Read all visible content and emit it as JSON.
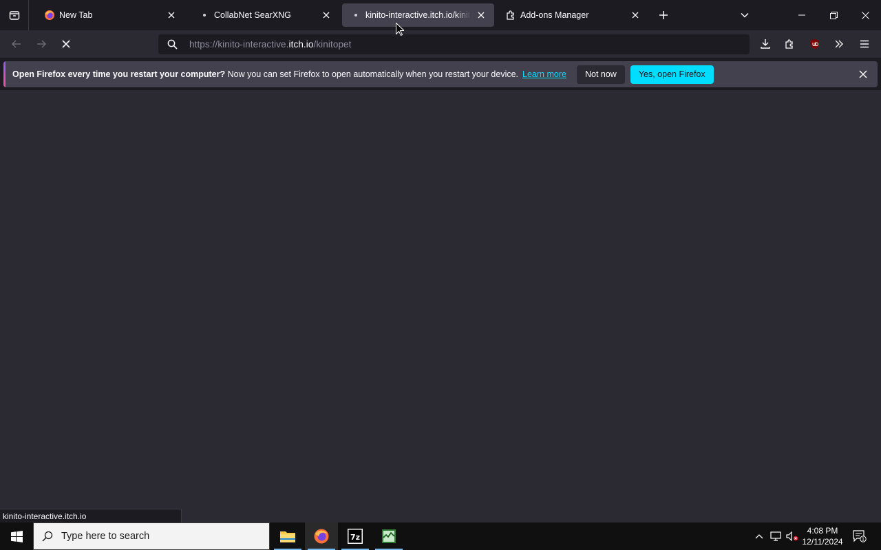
{
  "tabs": [
    {
      "label": "New Tab",
      "favicon": "firefox-icon",
      "selected": false
    },
    {
      "label": "CollabNet SearXNG",
      "favicon": "loading-dot",
      "selected": false
    },
    {
      "label": "kinito-interactive.itch.io/kinitopet",
      "favicon": "loading-dot",
      "selected": true
    },
    {
      "label": "Add-ons Manager",
      "favicon": "puzzle-icon",
      "selected": false
    }
  ],
  "urlbar": {
    "prefix": "https://kinito-interactive.",
    "host": "itch.io",
    "path": "/kinitopet"
  },
  "notification": {
    "title": "Open Firefox every time you restart your computer?",
    "message": " Now you can set Firefox to open automatically when you restart your device.",
    "learn_more": "Learn more",
    "not_now": "Not now",
    "yes": "Yes, open Firefox"
  },
  "status_link": "kinito-interactive.itch.io",
  "taskbar": {
    "search_placeholder": "Type here to search",
    "time": "4:08 PM",
    "date": "12/11/2024",
    "notification_count": "1"
  },
  "colors": {
    "accent": "#00ddff",
    "toolbar": "#2b2a33",
    "tab_selected": "#42414d"
  }
}
